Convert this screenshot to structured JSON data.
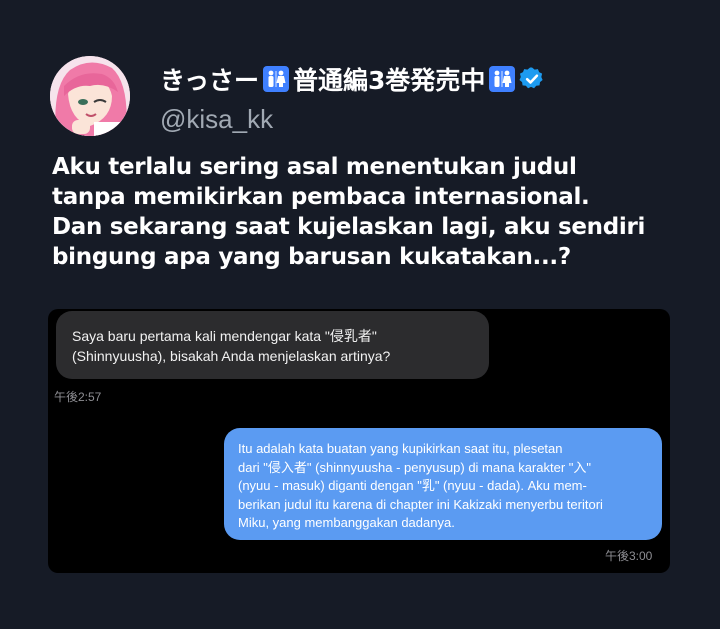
{
  "profile": {
    "display_name": "きっさー🚻普通編3巻発売中🚻",
    "name_text": "きっさー",
    "name_mid": "普通編3巻発売中",
    "handle": "@kisa_kk",
    "verified": true,
    "badge_icon": "restroom-emoji",
    "colors": {
      "verified": "#1d9bf0",
      "badge": "#3f80ff"
    }
  },
  "tweet": {
    "lines": [
      "Aku terlalu sering asal menentukan judul",
      "tanpa memikirkan pembaca internasional.",
      "Dan sekarang saat kujelaskan lagi, aku sendiri",
      "bingung apa yang barusan kukatakan...?"
    ]
  },
  "chat": {
    "incoming": {
      "lines": [
        "Saya baru pertama kali mendengar kata \"侵乳者\"",
        "(Shinnyuusha), bisakah Anda menjelaskan artinya?"
      ],
      "time": "午後2:57"
    },
    "outgoing": {
      "lines": [
        "Itu adalah kata buatan yang kupikirkan saat itu, plesetan",
        "dari \"侵入者\" (shinnyuusha - penyusup) di mana karakter \"入\"",
        "(nyuu - masuk) diganti dengan \"乳\" (nyuu - dada). Aku mem-",
        "berikan judul itu karena di chapter ini Kakizaki menyerbu teritori",
        "Miku, yang membanggakan dadanya."
      ],
      "time": "午後3:00"
    },
    "colors": {
      "background": "#000000",
      "incoming": "#2c2c2e",
      "outgoing": "#5b9bf2"
    }
  }
}
